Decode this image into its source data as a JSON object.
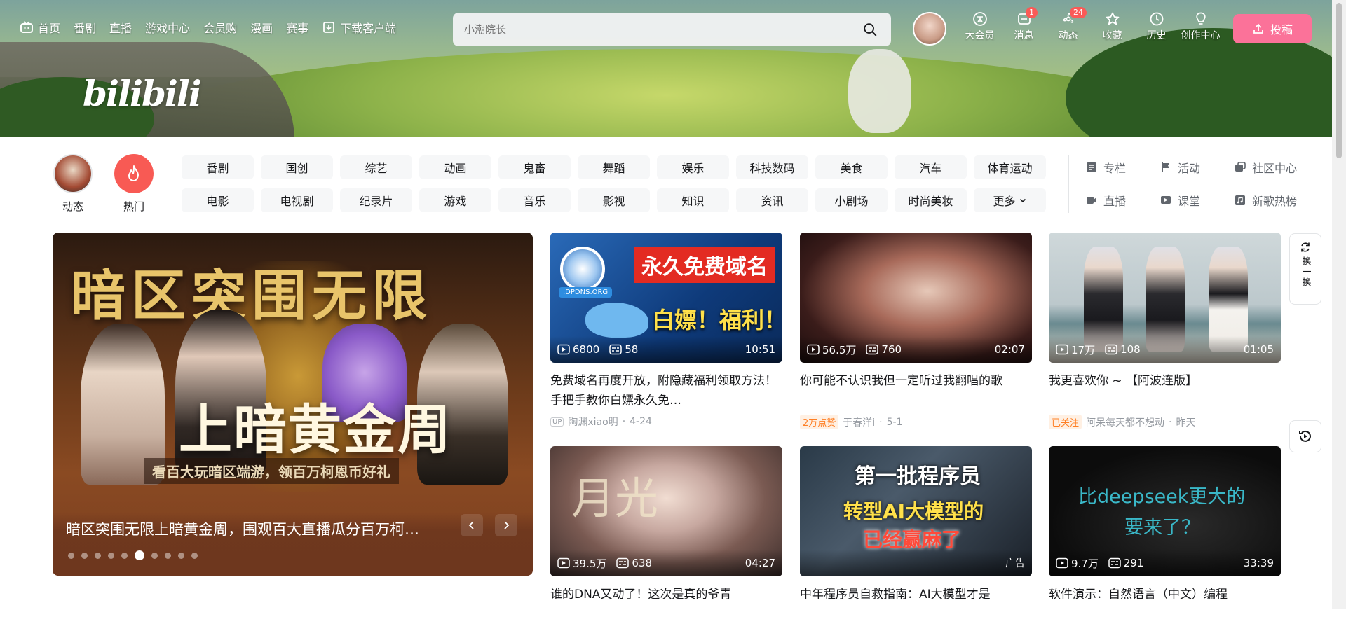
{
  "header": {
    "logo_text": "bilibili",
    "nav": [
      {
        "label": "首页",
        "icon": "tv-icon"
      },
      {
        "label": "番剧"
      },
      {
        "label": "直播"
      },
      {
        "label": "游戏中心"
      },
      {
        "label": "会员购"
      },
      {
        "label": "漫画"
      },
      {
        "label": "赛事"
      },
      {
        "label": "下载客户端",
        "icon": "download-icon"
      }
    ],
    "search": {
      "placeholder": "小潮院长"
    },
    "user_icons": [
      {
        "label": "大会员",
        "icon": "vip-icon",
        "badge": ""
      },
      {
        "label": "消息",
        "icon": "message-icon",
        "badge": "1"
      },
      {
        "label": "动态",
        "icon": "dynamic-icon",
        "badge": "24"
      },
      {
        "label": "收藏",
        "icon": "star-icon",
        "badge": ""
      },
      {
        "label": "历史",
        "icon": "clock-icon",
        "badge": ""
      },
      {
        "label": "创作中心",
        "icon": "bulb-icon",
        "badge": ""
      }
    ],
    "upload_label": "投稿",
    "accent": "#fb7299"
  },
  "channels": {
    "left": [
      {
        "label": "动态"
      },
      {
        "label": "热门"
      }
    ],
    "tags": [
      "番剧",
      "国创",
      "综艺",
      "动画",
      "鬼畜",
      "舞蹈",
      "娱乐",
      "科技数码",
      "美食",
      "汽车",
      "体育运动",
      "电影",
      "电视剧",
      "纪录片",
      "游戏",
      "音乐",
      "影视",
      "知识",
      "资讯",
      "小剧场",
      "时尚美妆",
      "更多"
    ],
    "right": [
      {
        "label": "专栏",
        "icon": "column-icon"
      },
      {
        "label": "活动",
        "icon": "flag-icon"
      },
      {
        "label": "社区中心",
        "icon": "community-icon"
      },
      {
        "label": "直播",
        "icon": "live-icon"
      },
      {
        "label": "课堂",
        "icon": "classroom-icon"
      },
      {
        "label": "新歌热榜",
        "icon": "music-icon"
      }
    ]
  },
  "carousel": {
    "big_title": "暗区突围无限",
    "mid_title": "上暗黄金周",
    "sub_line": "看百大玩暗区端游，领百万柯恩币好礼",
    "caption": "暗区突围无限上暗黄金周，围观百大直播瓜分百万柯…",
    "dot_count": 10,
    "active_dot": 5
  },
  "videos": [
    {
      "title": "免费域名再度开放，附隐藏福利领取方法！ 手把手教你白嫖永久免…",
      "views": "6800",
      "danmaku": "58",
      "duration": "10:51",
      "author": "陶渊xiao明",
      "date": "4-24",
      "tag": "",
      "thumb_text": [
        "永久免费域名",
        "白嫖！福利！",
        ".DPDNS.ORG"
      ]
    },
    {
      "title": "你可能不认识我但一定听过我翻唱的歌",
      "views": "56.5万",
      "danmaku": "760",
      "duration": "02:07",
      "author": "于春洋i",
      "date": "5-1",
      "tag": "2万点赞"
    },
    {
      "title": "我更喜欢你 ~ 【阿波连版】",
      "views": "17万",
      "danmaku": "108",
      "duration": "01:05",
      "author": "阿呆每天都不想动",
      "date": "昨天",
      "tag": "已关注"
    },
    {
      "title": "谁的DNA又动了！这次是真的爷青",
      "views": "39.5万",
      "danmaku": "638",
      "duration": "04:27",
      "thumb_text": [
        "月光"
      ]
    },
    {
      "title": "中年程序员自救指南：AI大模型才是",
      "ad": "广告",
      "thumb_text": [
        "第一批程序员",
        "转型AI大模型的",
        "已经赢麻了"
      ]
    },
    {
      "title": "软件演示：自然语言（中文）编程",
      "views": "9.7万",
      "danmaku": "291",
      "duration": "33:39",
      "thumb_text": [
        "比deepseek更大的",
        "要来了？"
      ]
    }
  ],
  "float": {
    "refresh_label": "换一换"
  }
}
